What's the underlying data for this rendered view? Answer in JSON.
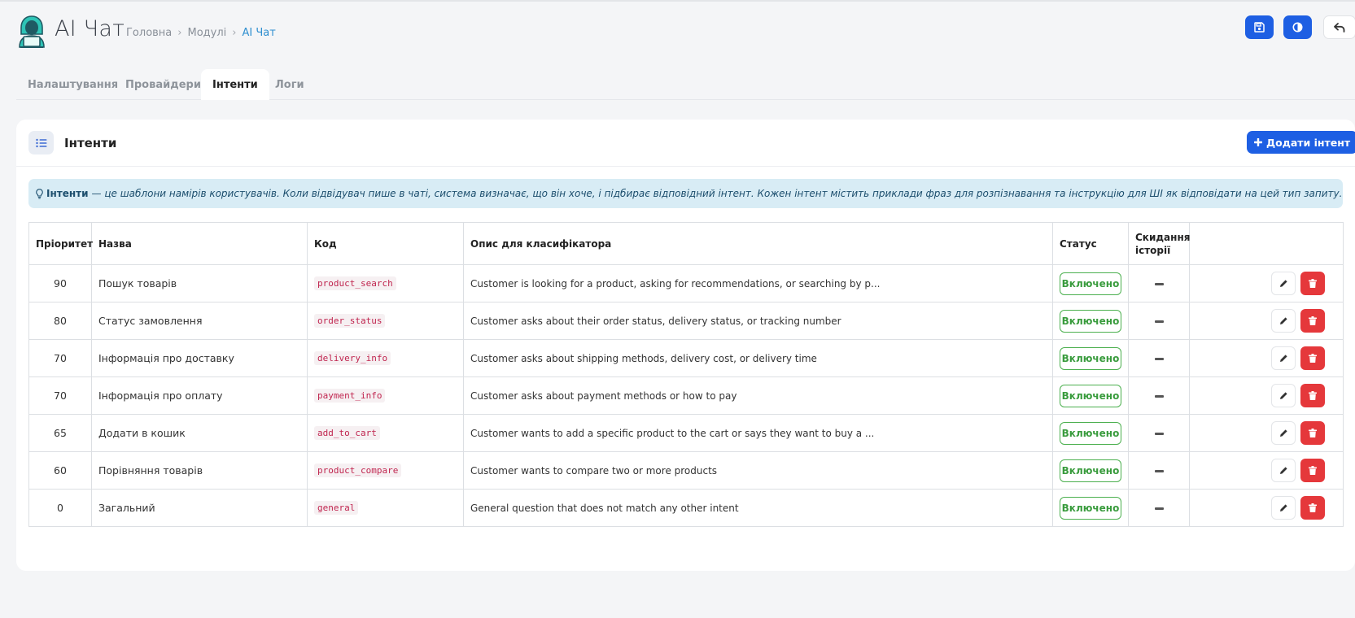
{
  "header": {
    "app_title": "AI Чат",
    "breadcrumb": [
      "Головна",
      "Модулі",
      "AI Чат"
    ]
  },
  "tabs": [
    "Налаштування",
    "Провайдери",
    "Інтенти",
    "Логи"
  ],
  "active_tab": "Інтенти",
  "card": {
    "title": "Інтенти",
    "add_button": "Додати інтент"
  },
  "info": {
    "bold": "Інтенти",
    "text": "— це шаблони намірів користувачів. Коли відвідувач пише в чаті, система визначає, що він хоче, і підбирає відповідний інтент. Кожен інтент містить приклади фраз для розпізнавання та інструкцію для ШІ як відповідати на цей тип запиту."
  },
  "table": {
    "headers": {
      "priority": "Пріоритет",
      "name": "Назва",
      "code": "Код",
      "description": "Опис для класифікатора",
      "status": "Статус",
      "reset": "Скидання історії"
    },
    "rows": [
      {
        "priority": "90",
        "name": "Пошук товарів",
        "code": "product_search",
        "description": "Customer is looking for a product, asking for recommendations, or searching by p...",
        "status": "Включено"
      },
      {
        "priority": "80",
        "name": "Статус замовлення",
        "code": "order_status",
        "description": "Customer asks about their order status, delivery status, or tracking number",
        "status": "Включено"
      },
      {
        "priority": "70",
        "name": "Інформація про доставку",
        "code": "delivery_info",
        "description": "Customer asks about shipping methods, delivery cost, or delivery time",
        "status": "Включено"
      },
      {
        "priority": "70",
        "name": "Інформація про оплату",
        "code": "payment_info",
        "description": "Customer asks about payment methods or how to pay",
        "status": "Включено"
      },
      {
        "priority": "65",
        "name": "Додати в кошик",
        "code": "add_to_cart",
        "description": "Customer wants to add a specific product to the cart or says they want to buy a ...",
        "status": "Включено"
      },
      {
        "priority": "60",
        "name": "Порівняння товарів",
        "code": "product_compare",
        "description": "Customer wants to compare two or more products",
        "status": "Включено"
      },
      {
        "priority": "0",
        "name": "Загальний",
        "code": "general",
        "description": "General question that does not match any other intent",
        "status": "Включено"
      }
    ]
  },
  "colors": {
    "primary": "#1e5fe3",
    "danger": "#e5383b",
    "success": "#3a9c3e",
    "info_bg": "#d8ecf5",
    "logo": "#2ec4b6"
  }
}
